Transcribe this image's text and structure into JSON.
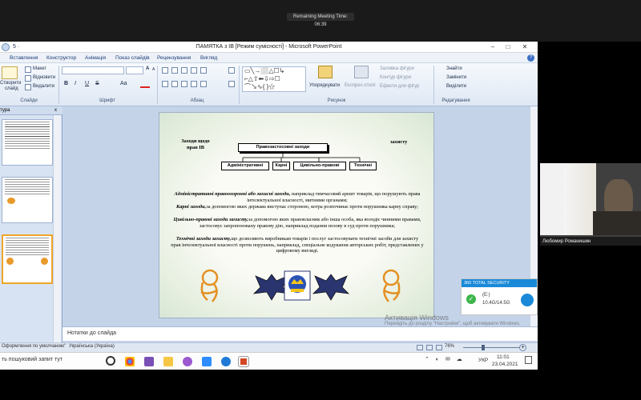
{
  "meeting": {
    "timer": "Remaining Meeting Time: 06:39"
  },
  "window": {
    "title": "ПАМЯТКА з IB [Режим сумісності] - Microsoft PowerPoint",
    "qat": "5 ·"
  },
  "tabs": [
    "Вставлення",
    "Конструктор",
    "Анімація",
    "Показ слайдів",
    "Рецензування",
    "Вигляд"
  ],
  "ribbon": {
    "slides": {
      "btn_top": "Створити",
      "btn_bottom": "слайд",
      "layout": "Макет",
      "reset": "Відновити",
      "delete": "Видалити",
      "label": "Слайди"
    },
    "font": {
      "label": "Шрифт",
      "bold": "B",
      "italic": "I",
      "underline": "U",
      "strike": "S",
      "case": "Aa",
      "grow": "A",
      "shrink": "A"
    },
    "paragraph": {
      "label": "Абзац"
    },
    "drawing": {
      "arrange": "Упорядкувати",
      "quick_styles": "Експрес-стилі",
      "fill": "Заливка фігури",
      "outline": "Контур фігури",
      "effects": "Ефекти для фігур",
      "label": "Рисунок"
    },
    "editing": {
      "find": "Знайти",
      "replace": "Замінити",
      "select": "Виділити",
      "label": "Редагування"
    }
  },
  "outline": {
    "head": "тура",
    "close": "x"
  },
  "slide": {
    "left_title": "Заходи щодо прав IB",
    "right_title": "захисту",
    "root": "Правозастосовні заходи",
    "nodes": [
      "Адміністративні",
      "Карні",
      "Цивільно-правові",
      "Технічні"
    ],
    "p1_b": "Адміністративні правоохоронні або захисні заходи,",
    "p1": " наприклад тимчасовий арешт товарів, що порушують права інтелектуальної власності, митними органами;",
    "p2_b": "Карні заходи,",
    "p2": "за допомогою яких держава виступає стороною, котра розпочинає проти порушника карну справу;",
    "p3_b": "Цивільно-правові заходи захисту,",
    "p3": "за допомогою яких правовласник або інша особа, яка володіє чинними правами, застосовує запропоновану правову дію, наприклад подання позову в суд проти порушника;",
    "p4_b": "Технічні заходи захисту,",
    "p4": "що дозволяють виробникам товарів і послуг застосовувати технічні засоби для захисту прав інтелектуальної власності проти порушень, наприклад, спеціальне кодування авторських робіт, представлених у цифровому вигляді."
  },
  "notes": {
    "placeholder": "Нотатки до слайда"
  },
  "status": {
    "theme": "Оформлення по умолчанию\"",
    "lang": "Українська (Україна)",
    "zoom": "76%"
  },
  "taskbar": {
    "search": "ть пошуковий запит тут",
    "lang": "УКР",
    "time": "11:01",
    "date": "23.04.2021"
  },
  "video": {
    "name": "Любомир Романишин"
  },
  "antivirus": {
    "title": "360 TOTAL SECURITY",
    "drive": "(E:)",
    "size": "10.4G/14.5G"
  },
  "activation": {
    "line1": "Активація Windows",
    "line2": "Перейдіть до розділу \"Настройки\", щоб активувати Windows."
  },
  "colors": {
    "ribbon_text": "#1b3c78",
    "editor_bg": "#c4d3e8",
    "accent_orange": "#f0a52a",
    "meet_bg": "#1a1a1a"
  }
}
